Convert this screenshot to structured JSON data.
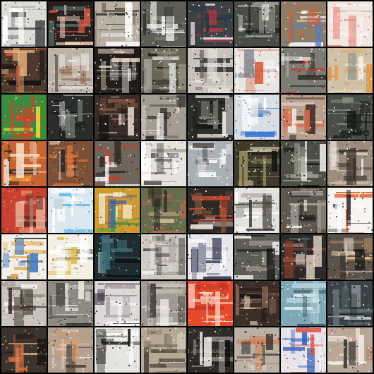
{
  "grid": {
    "rows": 8,
    "cols": 8,
    "separator_color": "#000000",
    "tiles": [
      {
        "bg": "#dcdcd6",
        "accents": [
          "#ffffff",
          "#7b7f86",
          "#2c2f33"
        ]
      },
      {
        "bg": "#2a1f1d",
        "accents": [
          "#e7583e",
          "#f2d7c2",
          "#4e6a62"
        ]
      },
      {
        "bg": "#b8b0a3",
        "accents": [
          "#fefefe",
          "#5a4a41",
          "#1e1c19"
        ]
      },
      {
        "bg": "#5d5f55",
        "accents": [
          "#f4f4f1",
          "#1a1a18",
          "#8e8f86"
        ]
      },
      {
        "bg": "#3e4244",
        "accents": [
          "#f0eaeb",
          "#b53a44",
          "#1f3a43"
        ]
      },
      {
        "bg": "#494d46",
        "accents": [
          "#f5f3ef",
          "#1a1c1a",
          "#a3a69c"
        ]
      },
      {
        "bg": "#8e7d63",
        "accents": [
          "#fdfdfd",
          "#4f7fc8",
          "#d95a2f"
        ]
      },
      {
        "bg": "#f3e6df",
        "accents": [
          "#ea6f61",
          "#f7f0ee",
          "#c0b6ad"
        ]
      },
      {
        "bg": "#4c3a2f",
        "accents": [
          "#e8b07a",
          "#17110f",
          "#c95936"
        ]
      },
      {
        "bg": "#bdb3a7",
        "accents": [
          "#f8f6f3",
          "#3e3a36",
          "#8d5b42"
        ]
      },
      {
        "bg": "#201d1b",
        "accents": [
          "#e8d2bf",
          "#6c6a5e",
          "#f2f1ee"
        ]
      },
      {
        "bg": "#6a6557",
        "accents": [
          "#fbfbfa",
          "#1d1d1c",
          "#9a9483"
        ]
      },
      {
        "bg": "#c8c2bb",
        "accents": [
          "#111111",
          "#e9e6e2",
          "#595652"
        ]
      },
      {
        "bg": "#e7e4e1",
        "accents": [
          "#d65b3a",
          "#ffffff",
          "#7b8590"
        ]
      },
      {
        "bg": "#7d7c73",
        "accents": [
          "#f1efea",
          "#c33a32",
          "#2f2d2a"
        ]
      },
      {
        "bg": "#cfc2a6",
        "accents": [
          "#e59642",
          "#f8f4e8",
          "#5a6b7a"
        ]
      },
      {
        "bg": "#3a8c3e",
        "accents": [
          "#f1e537",
          "#2a58c6",
          "#e03a2b"
        ]
      },
      {
        "bg": "#2b2d2a",
        "accents": [
          "#6f7a6f",
          "#e9e9e4",
          "#121311"
        ]
      },
      {
        "bg": "#382d28",
        "accents": [
          "#8e5b45",
          "#e7dbcf",
          "#121010"
        ]
      },
      {
        "bg": "#a49c91",
        "accents": [
          "#f5f3ef",
          "#2a2724",
          "#6a645c"
        ]
      },
      {
        "bg": "#2e2f2a",
        "accents": [
          "#f0eeea",
          "#7a7b72",
          "#151614"
        ]
      },
      {
        "bg": "#d9dde4",
        "accents": [
          "#2f6fd4",
          "#ffffff",
          "#8d96a3"
        ]
      },
      {
        "bg": "#b9a18f",
        "accents": [
          "#f2e7de",
          "#3a2c25",
          "#d76b4c"
        ]
      },
      {
        "bg": "#4a4e48",
        "accents": [
          "#e4e2dc",
          "#1a1b19",
          "#8a8d83"
        ]
      },
      {
        "bg": "#c76531",
        "accents": [
          "#f4a23d",
          "#3a2a22",
          "#f1e4d5"
        ]
      },
      {
        "bg": "#7a5039",
        "accents": [
          "#e3763a",
          "#f7ede2",
          "#2b211c"
        ]
      },
      {
        "bg": "#6e665b",
        "accents": [
          "#ffffff",
          "#c43b2b",
          "#2b2722"
        ]
      },
      {
        "bg": "#e5e2de",
        "accents": [
          "#2c2927",
          "#8b857d",
          "#ffffff"
        ]
      },
      {
        "bg": "#a9b0b3",
        "accents": [
          "#ffffff",
          "#3e3a36",
          "#d5d9da"
        ]
      },
      {
        "bg": "#3f3b2c",
        "accents": [
          "#9b9163",
          "#151411",
          "#e1d9b6"
        ]
      },
      {
        "bg": "#4d4f44",
        "accents": [
          "#f2f1ec",
          "#1a1b17",
          "#9c9e90"
        ]
      },
      {
        "bg": "#9c8c7b",
        "accents": [
          "#f6f2ee",
          "#3b332c",
          "#c8b8a6"
        ]
      },
      {
        "bg": "#c8432f",
        "accents": [
          "#e57e62",
          "#f3c0a8",
          "#5b2b24"
        ]
      },
      {
        "bg": "#dce8ef",
        "accents": [
          "#3aa6e5",
          "#ffffff",
          "#c7d4db"
        ]
      },
      {
        "bg": "#cf9b2d",
        "accents": [
          "#3b9f3a",
          "#f7f1de",
          "#2d4fbf"
        ]
      },
      {
        "bg": "#676c4d",
        "accents": [
          "#e8c7a8",
          "#2a2b23",
          "#b46b4c"
        ]
      },
      {
        "bg": "#2d2926",
        "accents": [
          "#e94f32",
          "#f5eee7",
          "#8e5b41"
        ]
      },
      {
        "bg": "#e3e2de",
        "accents": [
          "#383632",
          "#ffffff",
          "#9b978f"
        ]
      },
      {
        "bg": "#5f574d",
        "accents": [
          "#f2eee8",
          "#1e1b18",
          "#a59e92"
        ]
      },
      {
        "bg": "#f6f3f0",
        "accents": [
          "#d65e2b",
          "#1c1917",
          "#ffffff"
        ]
      },
      {
        "bg": "#f2efe8",
        "accents": [
          "#3e7ac4",
          "#e2a23c",
          "#2b2a25"
        ]
      },
      {
        "bg": "#f3efe4",
        "accents": [
          "#d9b33a",
          "#ffffff",
          "#6e6a5d"
        ]
      },
      {
        "bg": "#1f2c30",
        "accents": [
          "#3e6e7a",
          "#c9d7d6",
          "#0f1314"
        ]
      },
      {
        "bg": "#cfc9c3",
        "accents": [
          "#ffffff",
          "#4e4a45",
          "#9f988f"
        ]
      },
      {
        "bg": "#e8e6ea",
        "accents": [
          "#3a3d50",
          "#ffffff",
          "#8f91a3"
        ]
      },
      {
        "bg": "#5d5c55",
        "accents": [
          "#f2f0ea",
          "#151513",
          "#a9a698"
        ]
      },
      {
        "bg": "#2c2926",
        "accents": [
          "#8a3f2c",
          "#e8d9ca",
          "#4d5a5f"
        ]
      },
      {
        "bg": "#5b5249",
        "accents": [
          "#d5a56c",
          "#1a1714",
          "#e9dfd3"
        ]
      },
      {
        "bg": "#c9c3ba",
        "accents": [
          "#3a2f27",
          "#f5f1ec",
          "#8b7566"
        ]
      },
      {
        "bg": "#8f8b82",
        "accents": [
          "#201e1b",
          "#ece8e1",
          "#5a5650"
        ]
      },
      {
        "bg": "#ddd9d8",
        "accents": [
          "#35283b",
          "#ffffff",
          "#9b8e94"
        ]
      },
      {
        "bg": "#a19a92",
        "accents": [
          "#f4f0eb",
          "#3b3631",
          "#cfc6bc"
        ]
      },
      {
        "bg": "#e44b2c",
        "accents": [
          "#f7d0b6",
          "#b42c22",
          "#ffffff"
        ]
      },
      {
        "bg": "#3a2f29",
        "accents": [
          "#d9c3b0",
          "#16110f",
          "#8d6b56"
        ]
      },
      {
        "bg": "#7fa8b7",
        "accents": [
          "#e5f1f4",
          "#2a3e46",
          "#b9d3da"
        ]
      },
      {
        "bg": "#3a4245",
        "accents": [
          "#d8e2e6",
          "#161b1d",
          "#6c7d84"
        ]
      },
      {
        "bg": "#3a342d",
        "accents": [
          "#e4b884",
          "#151210",
          "#d76a3b"
        ]
      },
      {
        "bg": "#b3a08e",
        "accents": [
          "#f5ede4",
          "#4b3a2e",
          "#d99c6c"
        ]
      },
      {
        "bg": "#e6e4e1",
        "accents": [
          "#1f1e1c",
          "#ffffff",
          "#8f8a83"
        ]
      },
      {
        "bg": "#b6aa97",
        "accents": [
          "#f3ede3",
          "#4a4136",
          "#807565"
        ]
      },
      {
        "bg": "#2e2b28",
        "accents": [
          "#f5f2ee",
          "#0f0e0d",
          "#8b8377"
        ]
      },
      {
        "bg": "#b9b0a6",
        "accents": [
          "#f4f0eb",
          "#342d27",
          "#d57a4e"
        ]
      },
      {
        "bg": "#e8e3e9",
        "accents": [
          "#d94e3d",
          "#3764c0",
          "#ffffff"
        ]
      },
      {
        "bg": "#b7a89a",
        "accents": [
          "#f3ece5",
          "#3d342c",
          "#c46b4a"
        ]
      }
    ]
  }
}
